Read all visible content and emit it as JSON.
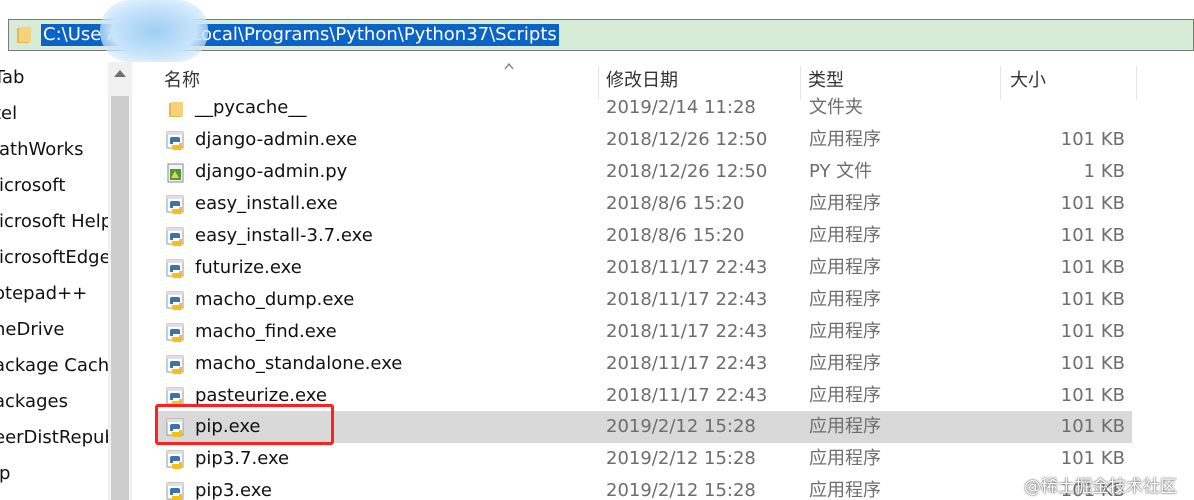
{
  "address": {
    "path": "C:\\Use          AppData\\Local\\Programs\\Python\\Python37\\Scripts"
  },
  "nav": {
    "items": [
      {
        "label": "Tab"
      },
      {
        "label": "tel"
      },
      {
        "label": "lathWorks"
      },
      {
        "label": "licrosoft"
      },
      {
        "label": "licrosoft Help"
      },
      {
        "label": "licrosoftEdge"
      },
      {
        "label": "otepad++"
      },
      {
        "label": "neDrive"
      },
      {
        "label": "ackage Cache"
      },
      {
        "label": "ackages"
      },
      {
        "label": "eerDistRepub"
      },
      {
        "label": "ip"
      }
    ]
  },
  "columns": {
    "name": "名称",
    "date": "修改日期",
    "type": "类型",
    "size": "大小"
  },
  "files": [
    {
      "name": "__pycache__",
      "date": "2019/2/14 11:28",
      "type": "文件夹",
      "size": "",
      "icon": "folder-icon"
    },
    {
      "name": "django-admin.exe",
      "date": "2018/12/26 12:50",
      "type": "应用程序",
      "size": "101 KB",
      "icon": "python-exe-icon"
    },
    {
      "name": "django-admin.py",
      "date": "2018/12/26 12:50",
      "type": "PY 文件",
      "size": "1 KB",
      "icon": "python-file-icon"
    },
    {
      "name": "easy_install.exe",
      "date": "2018/8/6 15:20",
      "type": "应用程序",
      "size": "101 KB",
      "icon": "python-exe-icon"
    },
    {
      "name": "easy_install-3.7.exe",
      "date": "2018/8/6 15:20",
      "type": "应用程序",
      "size": "101 KB",
      "icon": "python-exe-icon"
    },
    {
      "name": "futurize.exe",
      "date": "2018/11/17 22:43",
      "type": "应用程序",
      "size": "101 KB",
      "icon": "python-exe-icon"
    },
    {
      "name": "macho_dump.exe",
      "date": "2018/11/17 22:43",
      "type": "应用程序",
      "size": "101 KB",
      "icon": "python-exe-icon"
    },
    {
      "name": "macho_find.exe",
      "date": "2018/11/17 22:43",
      "type": "应用程序",
      "size": "101 KB",
      "icon": "python-exe-icon"
    },
    {
      "name": "macho_standalone.exe",
      "date": "2018/11/17 22:43",
      "type": "应用程序",
      "size": "101 KB",
      "icon": "python-exe-icon"
    },
    {
      "name": "pasteurize.exe",
      "date": "2018/11/17 22:43",
      "type": "应用程序",
      "size": "101 KB",
      "icon": "python-exe-icon"
    },
    {
      "name": "pip.exe",
      "date": "2019/2/12 15:28",
      "type": "应用程序",
      "size": "101 KB",
      "icon": "python-exe-icon",
      "selected": true
    },
    {
      "name": "pip3.7.exe",
      "date": "2019/2/12 15:28",
      "type": "应用程序",
      "size": "101 KB",
      "icon": "python-exe-icon"
    },
    {
      "name": "pip3.exe",
      "date": "2019/2/12 15:28",
      "type": "应用程序",
      "size": "101 KB",
      "icon": "python-exe-icon"
    }
  ],
  "watermark": "@稀土掘金技术社区",
  "colors": {
    "selection": "#d9d9d9",
    "address_highlight": "#0b63c8",
    "address_bar_bg": "#d6ecd6",
    "annotation_box": "#ff2020"
  }
}
